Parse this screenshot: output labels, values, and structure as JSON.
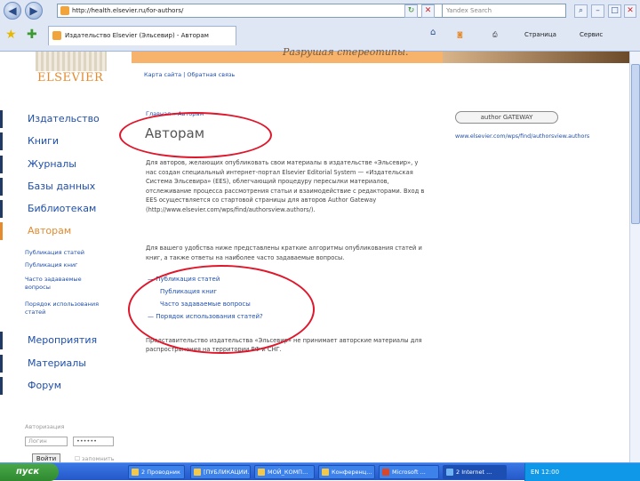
{
  "browser": {
    "url": "http://health.elsevier.ru/for-authors/",
    "search_placeholder": "Yandex Search",
    "tab_title": "Издательство Elsevier (Эльсевир) - Авторам",
    "page_menu": "Страница",
    "tools_menu": "Сервис"
  },
  "header": {
    "logo": "ELSEVIER",
    "tagline": "Разрушая стереотипы.",
    "top_links": "Карта сайта | Обратная связь"
  },
  "sidebar": {
    "items": [
      {
        "label": "Издательство"
      },
      {
        "label": "Книги"
      },
      {
        "label": "Журналы"
      },
      {
        "label": "Базы данных"
      },
      {
        "label": "Библиотекам"
      },
      {
        "label": "Авторам"
      },
      {
        "label": "Мероприятия"
      },
      {
        "label": "Материалы"
      },
      {
        "label": "Форум"
      }
    ],
    "sub_items": [
      "Публикация статей",
      "Публикация книг",
      "Часто задаваемые вопросы",
      "Порядок использования статей"
    ],
    "login": {
      "title": "Авторизация",
      "login_placeholder": "Логин",
      "password_value": "••••••",
      "button": "Войти",
      "remember": "запомнить"
    }
  },
  "main": {
    "breadcrumb": "Главная » Авторам",
    "title": "Авторам",
    "paragraph1": "Для авторов, желающих опубликовать свои материалы в издательстве «Эльсевир», у нас создан специальный интернет-портал Elsevier Editorial System — «Издательская Система Эльсевира» (EES), облегчающий процедуру пересылки материалов, отслеживание процесса рассмотрения статьи и взаимодействие с редакторами. Вход в EES осуществляется со стартовой страницы для авторов Author Gateway (http://www.elsevier.com/wps/find/authorsview.authors/).",
    "paragraph2": "Для вашего удобства ниже представлены краткие алгоритмы опубликования статей и книг, а также ответы на наиболее часто задаваемые вопросы.",
    "links": [
      "Публикация статей",
      "Публикация книг",
      "Часто задаваемые вопросы",
      "Порядок использования статей?"
    ],
    "footnote": "Представительство издательства «Эльсевир» не принимает авторские материалы для распространения на территории РФ и СНГ."
  },
  "gateway": {
    "label": "author GATEWAY",
    "url": "www.elsevier.com/wps/find/authorsview.authors"
  },
  "taskbar": {
    "start": "пуск",
    "tasks": [
      "2 Проводник",
      "[ПУБЛИКАЦИИ...",
      "МОЙ_КОМП...",
      "Конференц...",
      "Microsoft ...",
      "2 Internet ..."
    ],
    "tray": "EN  12:00"
  }
}
